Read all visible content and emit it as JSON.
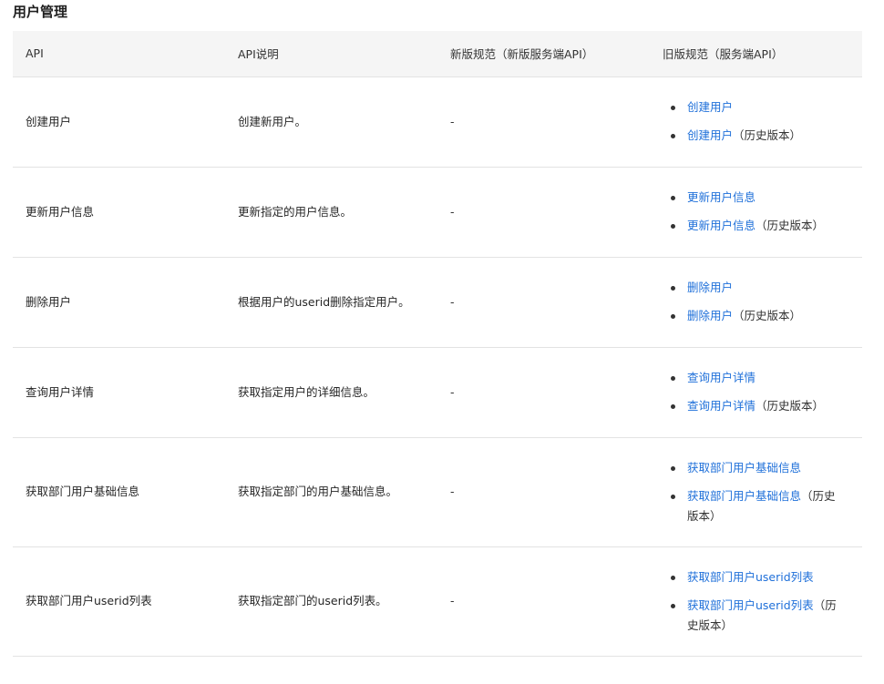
{
  "section": {
    "title": "用户管理"
  },
  "table": {
    "headers": [
      "API",
      "API说明",
      "新版规范（新版服务端API）",
      "旧版规范（服务端API）"
    ],
    "rows": [
      {
        "api": "创建用户",
        "desc": "创建新用户。",
        "new_spec": "-",
        "old_links": [
          {
            "text": "创建用户",
            "note": ""
          },
          {
            "text": "创建用户",
            "note": "（历史版本）"
          }
        ]
      },
      {
        "api": "更新用户信息",
        "desc": "更新指定的用户信息。",
        "new_spec": "-",
        "old_links": [
          {
            "text": "更新用户信息",
            "note": ""
          },
          {
            "text": "更新用户信息",
            "note": "（历史版本）"
          }
        ]
      },
      {
        "api": "删除用户",
        "desc": "根据用户的userid删除指定用户。",
        "new_spec": "-",
        "old_links": [
          {
            "text": "删除用户",
            "note": ""
          },
          {
            "text": "删除用户",
            "note": "（历史版本）"
          }
        ]
      },
      {
        "api": "查询用户详情",
        "desc": "获取指定用户的详细信息。",
        "new_spec": "-",
        "old_links": [
          {
            "text": "查询用户详情",
            "note": ""
          },
          {
            "text": "查询用户详情",
            "note": "（历史版本）"
          }
        ]
      },
      {
        "api": "获取部门用户基础信息",
        "desc": "获取指定部门的用户基础信息。",
        "new_spec": "-",
        "old_links": [
          {
            "text": "获取部门用户基础信息",
            "note": ""
          },
          {
            "text": "获取部门用户基础信息",
            "note": "（历史版本）"
          }
        ]
      },
      {
        "api": "获取部门用户userid列表",
        "desc": "获取指定部门的userid列表。",
        "new_spec": "-",
        "old_links": [
          {
            "text": "获取部门用户userid列表",
            "note": ""
          },
          {
            "text": "获取部门用户userid列表",
            "note": "（历史版本）"
          }
        ]
      }
    ]
  },
  "colors": {
    "link": "#1e6fd9",
    "header_bg": "#f5f5f5",
    "border": "#e3e3e3"
  }
}
